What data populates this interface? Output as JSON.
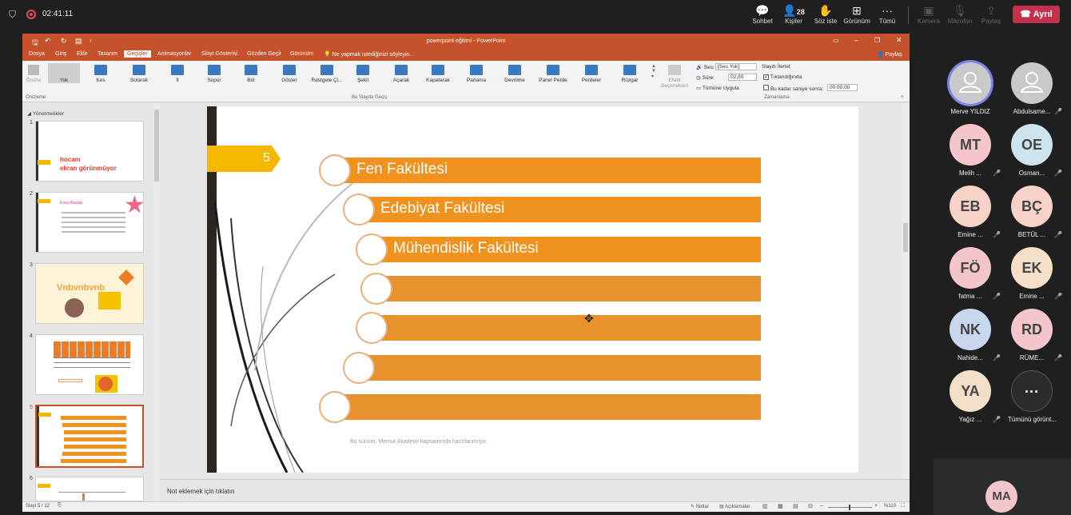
{
  "meeting": {
    "timer": "02:41:11",
    "actions": [
      {
        "label": "Sohbet",
        "icon": "chat-icon"
      },
      {
        "label": "Kişiler",
        "icon": "people-icon",
        "count": "28"
      },
      {
        "label": "Söz iste",
        "icon": "raise-hand-icon"
      },
      {
        "label": "Görünüm",
        "icon": "view-icon"
      },
      {
        "label": "Tümü",
        "icon": "more-icon"
      },
      {
        "label": "Kamera",
        "icon": "camera-icon"
      },
      {
        "label": "Mikrofon",
        "icon": "mic-icon"
      },
      {
        "label": "Paylaş",
        "icon": "share-icon"
      }
    ],
    "leave_label": "Ayrıl"
  },
  "ppt": {
    "window_title": "powerpoint eğitimi - PowerPoint",
    "tabs": [
      "Dosya",
      "Giriş",
      "Ekle",
      "Tasarım",
      "Geçişler",
      "Animasyonlar",
      "Slayt Gösterisi",
      "Gözden Geçir",
      "Görünüm"
    ],
    "tell_me": "Ne yapmak istediğinizi söyleyin...",
    "share_label": "Paylaş",
    "preview_label": "Önizle",
    "transitions": [
      "Yok",
      "Kes",
      "Solarak",
      "İt",
      "Süpür",
      "Böl",
      "Göster",
      "Rastgele Çi...",
      "Şekil",
      "Açarak",
      "Kapatarak",
      "Parlama",
      "Devrilme",
      "Panel Perde",
      "Perdeler",
      "Rüzgar"
    ],
    "effect_options": "Efekt Seçenekleri",
    "group_preview": "Önizleme",
    "group_transition": "Bu Slayda Geçiş",
    "group_timing": "Zamanlama",
    "sound_label": "Ses:",
    "sound_value": "[Ses Yok]",
    "duration_label": "Süre:",
    "duration_value": "02,00",
    "apply_all": "Tümüne Uygula",
    "advance_label": "Slaydı İlerlet",
    "on_click": "Tıklandığında",
    "after_label": "Bu kadar saniye sonra:",
    "after_value": "00:00,00",
    "section_label": "Yönetmelikler",
    "notes_placeholder": "Not eklemek için tıklatın",
    "status_slide": "Slayt 5 / 12",
    "status_notes": "Notlar",
    "status_comments": "Açıklamalar",
    "zoom": "%110"
  },
  "thumbs": [
    {
      "num": "1",
      "line1": "hocam",
      "line2": "ekran görünmüyor"
    },
    {
      "num": "2",
      "title": "Konu Başlığı"
    },
    {
      "num": "3",
      "title": "Vnbvnbvnb"
    },
    {
      "num": "4"
    },
    {
      "num": "5"
    },
    {
      "num": "6"
    }
  ],
  "slide": {
    "number": "5",
    "items": [
      "Fen Fakültesi",
      "Edebiyat Fakültesi",
      "Mühendislik Fakültesi",
      "",
      "",
      "",
      ""
    ],
    "footer": "Bu sunum, Memur Akademi kapsamında hazırlanmıştır."
  },
  "participants": [
    {
      "initials": "",
      "name": "Merve YILDIZ",
      "color": "#c9c9c9"
    },
    {
      "initials": "",
      "name": "Abdulsame...",
      "color": "#c9c9c9"
    },
    {
      "initials": "MT",
      "name": "Melih ...",
      "color": "#f4c6cc"
    },
    {
      "initials": "OE",
      "name": "Osman...",
      "color": "#cfe3ef"
    },
    {
      "initials": "EB",
      "name": "Emine ...",
      "color": "#f6d2c8"
    },
    {
      "initials": "BÇ",
      "name": "BETÜL ...",
      "color": "#f6d2c8"
    },
    {
      "initials": "FÖ",
      "name": "fatma ...",
      "color": "#f4c6cc"
    },
    {
      "initials": "EK",
      "name": "Emine ...",
      "color": "#f4e0c8"
    },
    {
      "initials": "NK",
      "name": "Nahide...",
      "color": "#c8d7ee"
    },
    {
      "initials": "RD",
      "name": "RÜME...",
      "color": "#f4c6cc"
    },
    {
      "initials": "YA",
      "name": "Yağız ...",
      "color": "#f4e0c8"
    },
    {
      "initials": "···",
      "name": "Tümünü görünt...",
      "color": "#2b2b2b"
    }
  ],
  "self_tile": {
    "initials": "MA"
  }
}
